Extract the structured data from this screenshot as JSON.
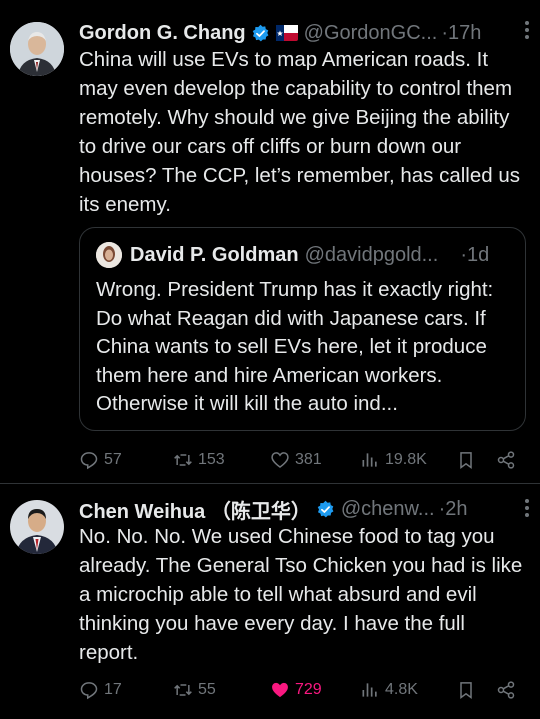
{
  "tweet1": {
    "name": "Gordon G. Chang",
    "handle": "@GordonGC...",
    "time": "·17h",
    "text": "China will use EVs to map American roads. It may even develop the capability to control them remotely. Why should we give Beijing the ability to drive our cars off cliffs or burn down our houses? The CCP, let’s remember, has called us its enemy.",
    "quote": {
      "name": "David P. Goldman",
      "handle": "@davidpgold...",
      "time": "·1d",
      "text": "Wrong. President Trump has it exactly right: Do what Reagan did with Japanese cars. If China wants to sell EVs here, let it produce them here and hire American workers. Otherwise it will kill the auto ind..."
    },
    "stats": {
      "replies": "57",
      "retweets": "153",
      "likes": "381",
      "views": "19.8K"
    }
  },
  "tweet2": {
    "name": "Chen Weihua （陈卫华）",
    "handle": "@chenw...",
    "time": "·2h",
    "text": "No. No. No. We used Chinese food to tag you already. The General Tso Chicken you had is like a microchip able to tell what absurd and evil thinking you have every day. I have the full report.",
    "stats": {
      "replies": "17",
      "retweets": "55",
      "likes": "729",
      "views": "4.8K"
    }
  },
  "colors": {
    "background": "#000000",
    "verified": "#1d9bf0",
    "liked": "#f91880",
    "muted": "#71767b"
  },
  "icons": [
    "verified-badge-icon",
    "flag-icon",
    "more-icon",
    "reply-icon",
    "retweet-icon",
    "like-icon",
    "views-icon",
    "bookmark-icon",
    "share-icon"
  ]
}
